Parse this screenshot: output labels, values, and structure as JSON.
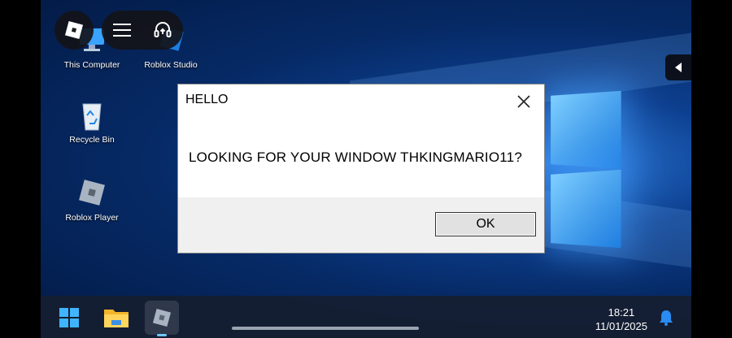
{
  "desktop": {
    "icons": [
      {
        "label": "This Computer"
      },
      {
        "label": "Roblox Studio"
      },
      {
        "label": "Recycle Bin"
      },
      {
        "label": "Roblox Player"
      }
    ]
  },
  "overlay": {
    "roblox_menu_icon": "roblox-logo-icon",
    "hamburger_icon": "menu-icon",
    "support_icon": "headset-icon",
    "side_tab_icon": "arrow-left-icon"
  },
  "dialog": {
    "title": "HELLO",
    "message": "LOOKING FOR YOUR WINDOW THKINGMARIO11?",
    "ok_label": "OK"
  },
  "taskbar": {
    "apps": [
      "start-icon",
      "file-explorer-icon",
      "roblox-app-icon"
    ],
    "time": "18:21",
    "date": "11/01/2025",
    "notification_icon": "bell-icon"
  },
  "colors": {
    "accent": "#1e7de0",
    "notification": "#2a8bf2"
  }
}
